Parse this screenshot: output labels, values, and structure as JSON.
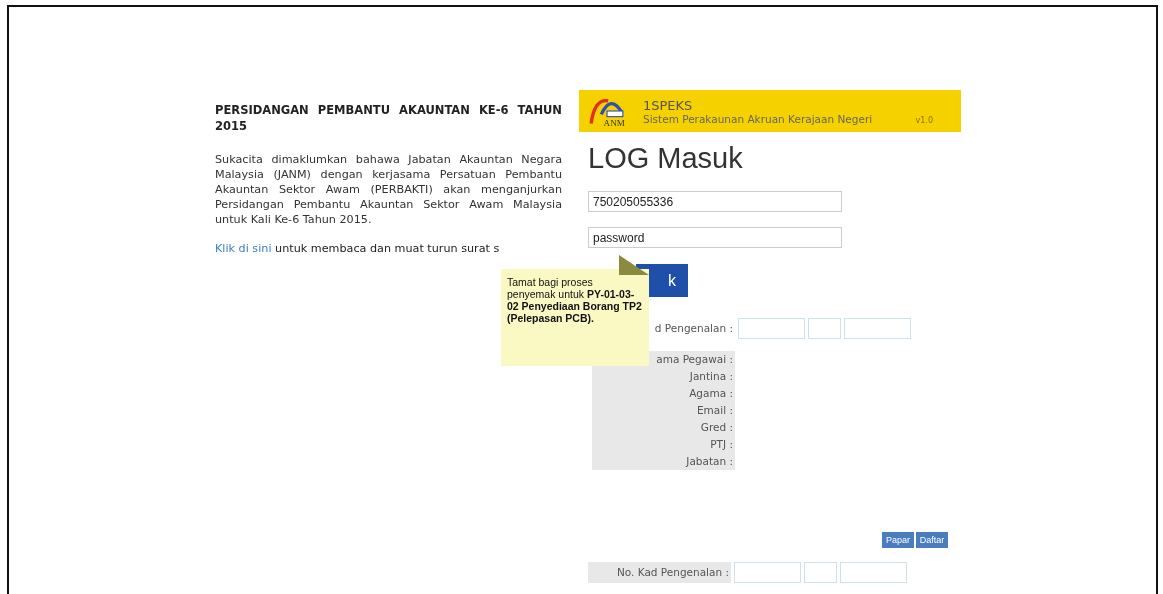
{
  "announcement": {
    "title": "PERSIDANGAN PEMBANTU AKAUNTAN KE-6 TAHUN 2015",
    "body": "Sukacita dimaklumkan bahawa Jabatan Akauntan Negara Malaysia (JANM) dengan kerjasama Persatuan Pembantu Akauntan Sektor Awam (PERBAKTI) akan menganjurkan Persidangan Pembantu Akauntan Sektor Awam Malaysia untuk Kali Ke-6 Tahun 2015.",
    "link": "Klik di sini",
    "link_rest": "untuk membaca dan muat turun surat s"
  },
  "header": {
    "logo_text": "ANM",
    "title": "1SPEKS",
    "subtitle": "Sistem Perakaunan Akruan Kerajaan Negeri",
    "version": "v1.0"
  },
  "login": {
    "heading": "LOG Masuk",
    "user_id": "750205055336",
    "password": "password",
    "button": "k"
  },
  "tooltip": {
    "text": "Tamat bagi proses penyemak untuk **PY-01-03-02 Penyediaan Borang TP2 (Pelepasan PCB).**"
  },
  "profile": {
    "id_label": "d Pengenalan :",
    "fields": [
      "ama Pegawai :",
      "Jantina :",
      "Agama :",
      "Email :",
      "Gred :",
      "PTJ :",
      "Jabatan :"
    ]
  },
  "actions": [
    "Papar",
    "Daftar"
  ],
  "lower_form": {
    "id_label": "No. Kad Pengenalan :"
  }
}
